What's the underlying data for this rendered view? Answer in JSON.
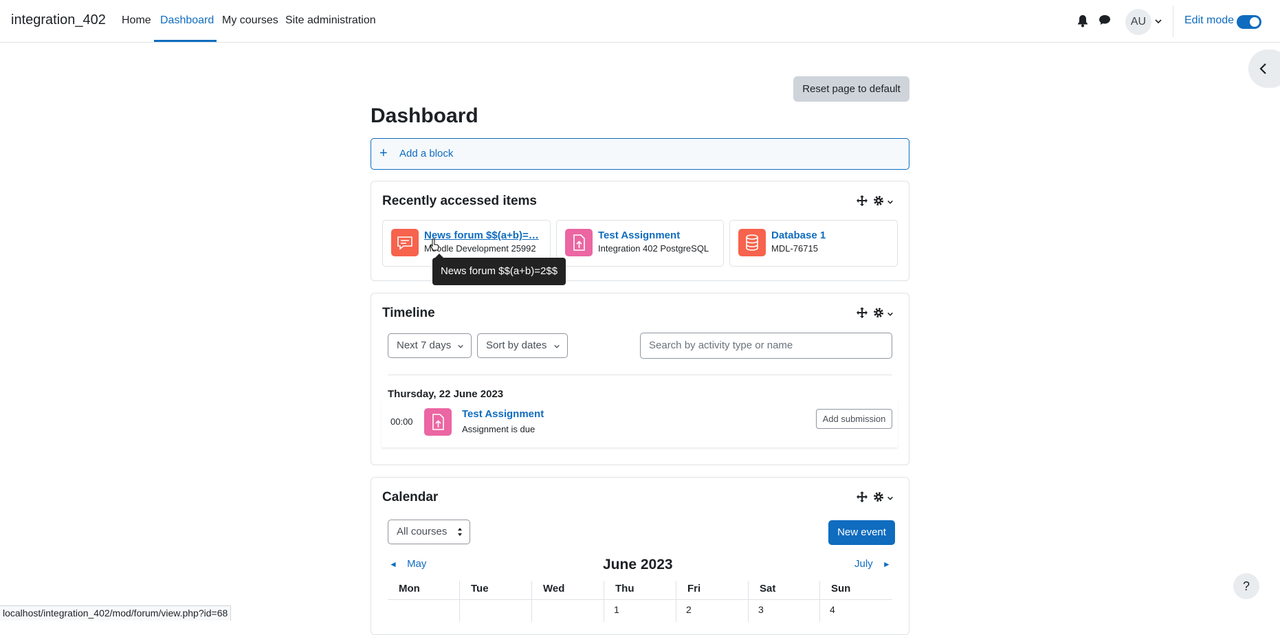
{
  "navbar": {
    "brand": "integration_402",
    "links": [
      "Home",
      "Dashboard",
      "My courses",
      "Site administration"
    ],
    "active": "Dashboard",
    "avatar_initials": "AU",
    "edit_mode_label": "Edit mode",
    "edit_mode_on": true
  },
  "main": {
    "reset_button": "Reset page to default",
    "title": "Dashboard",
    "add_block_plus": "+",
    "add_block_label": "Add a block"
  },
  "recent": {
    "title": "Recently accessed items",
    "items": [
      {
        "name": "News forum $$(a+b)=…",
        "course": "Moodle Development 25992",
        "icon": "forum-icon",
        "color": "#f7634d"
      },
      {
        "name": "Test Assignment",
        "course": "Integration 402 PostgreSQL",
        "icon": "assignment-icon",
        "color": "#eb66a2"
      },
      {
        "name": "Database 1",
        "course": "MDL-76715",
        "icon": "database-icon",
        "color": "#f7634d"
      }
    ],
    "tooltip": "News forum $$(a+b)=2$$"
  },
  "timeline": {
    "title": "Timeline",
    "filter": "Next 7 days",
    "sort": "Sort by dates",
    "search_placeholder": "Search by activity type or name",
    "date": "Thursday, 22 June 2023",
    "event": {
      "time": "00:00",
      "name": "Test Assignment",
      "desc": "Assignment is due",
      "action": "Add submission"
    }
  },
  "calendar": {
    "title": "Calendar",
    "course_filter": "All courses",
    "new_event": "New event",
    "prev": "May",
    "month": "June 2023",
    "next": "July",
    "prev_arrow": "◄",
    "next_arrow": "►",
    "weekdays": [
      "Mon",
      "Tue",
      "Wed",
      "Thu",
      "Fri",
      "Sat",
      "Sun"
    ],
    "first_row": [
      "",
      "",
      "",
      "1",
      "2",
      "3",
      "4"
    ]
  },
  "help_label": "?",
  "status_url": "localhost/integration_402/mod/forum/view.php?id=68",
  "colors": {
    "accent": "#0f6cbf",
    "assignment": "#eb66a2",
    "forum": "#f7634d"
  }
}
